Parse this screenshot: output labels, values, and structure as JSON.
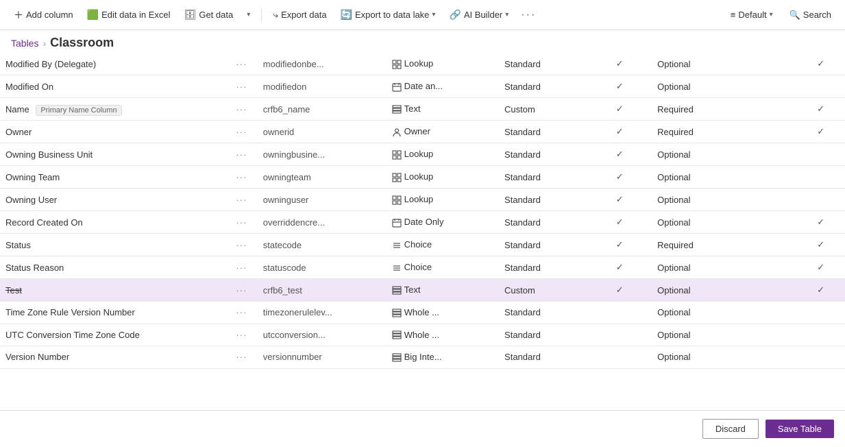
{
  "toolbar": {
    "add_column_label": "Add column",
    "edit_excel_label": "Edit data in Excel",
    "get_data_label": "Get data",
    "export_data_label": "Export data",
    "export_lake_label": "Export to data lake",
    "ai_builder_label": "AI Builder",
    "default_label": "Default",
    "search_label": "Search",
    "more_icon": "···"
  },
  "breadcrumb": {
    "tables_label": "Tables",
    "separator": "›",
    "current": "Classroom"
  },
  "rows": [
    {
      "name": "Modified By (Delegate)",
      "dots": "···",
      "logical": "modifiedonbe...",
      "type_icon": "⊞",
      "type": "Lookup",
      "custom": "Standard",
      "searchable": true,
      "required": "Optional",
      "managed": true
    },
    {
      "name": "Modified On",
      "dots": "···",
      "logical": "modifiedon",
      "type_icon": "📅",
      "type": "Date an...",
      "custom": "Standard",
      "searchable": true,
      "required": "Optional",
      "managed": false
    },
    {
      "name": "Name",
      "badge": "Primary Name Column",
      "dots": "···",
      "logical": "crfb6_name",
      "type_icon": "⊟",
      "type": "Text",
      "custom": "Custom",
      "searchable": true,
      "required": "Required",
      "managed": true
    },
    {
      "name": "Owner",
      "dots": "···",
      "logical": "ownerid",
      "type_icon": "👤",
      "type": "Owner",
      "custom": "Standard",
      "searchable": true,
      "required": "Required",
      "managed": true
    },
    {
      "name": "Owning Business Unit",
      "dots": "···",
      "logical": "owningbusine...",
      "type_icon": "⊞",
      "type": "Lookup",
      "custom": "Standard",
      "searchable": true,
      "required": "Optional",
      "managed": false
    },
    {
      "name": "Owning Team",
      "dots": "···",
      "logical": "owningteam",
      "type_icon": "⊞",
      "type": "Lookup",
      "custom": "Standard",
      "searchable": true,
      "required": "Optional",
      "managed": false
    },
    {
      "name": "Owning User",
      "dots": "···",
      "logical": "owninguser",
      "type_icon": "⊞",
      "type": "Lookup",
      "custom": "Standard",
      "searchable": true,
      "required": "Optional",
      "managed": false
    },
    {
      "name": "Record Created On",
      "dots": "···",
      "logical": "overriddencre...",
      "type_icon": "📅",
      "type": "Date Only",
      "custom": "Standard",
      "searchable": true,
      "required": "Optional",
      "managed": true
    },
    {
      "name": "Status",
      "dots": "···",
      "logical": "statecode",
      "type_icon": "≡",
      "type": "Choice",
      "custom": "Standard",
      "searchable": true,
      "required": "Required",
      "managed": true
    },
    {
      "name": "Status Reason",
      "dots": "···",
      "logical": "statuscode",
      "type_icon": "≡",
      "type": "Choice",
      "custom": "Standard",
      "searchable": true,
      "required": "Optional",
      "managed": true
    },
    {
      "name": "Test",
      "strikethrough": true,
      "dots": "···",
      "logical": "crfb6_test",
      "type_icon": "⊟",
      "type": "Text",
      "custom": "Custom",
      "searchable": true,
      "required": "Optional",
      "managed": true,
      "selected": true
    },
    {
      "name": "Time Zone Rule Version Number",
      "dots": "···",
      "logical": "timezonerulelev...",
      "type_icon": "⊟",
      "type": "Whole ...",
      "custom": "Standard",
      "searchable": false,
      "required": "Optional",
      "managed": false
    },
    {
      "name": "UTC Conversion Time Zone Code",
      "dots": "···",
      "logical": "utcconversion...",
      "type_icon": "⊟",
      "type": "Whole ...",
      "custom": "Standard",
      "searchable": false,
      "required": "Optional",
      "managed": false
    },
    {
      "name": "Version Number",
      "dots": "···",
      "logical": "versionnumber",
      "type_icon": "⊟",
      "type": "Big Inte...",
      "custom": "Standard",
      "searchable": false,
      "required": "Optional",
      "managed": false
    }
  ],
  "footer": {
    "discard_label": "Discard",
    "save_label": "Save Table"
  }
}
